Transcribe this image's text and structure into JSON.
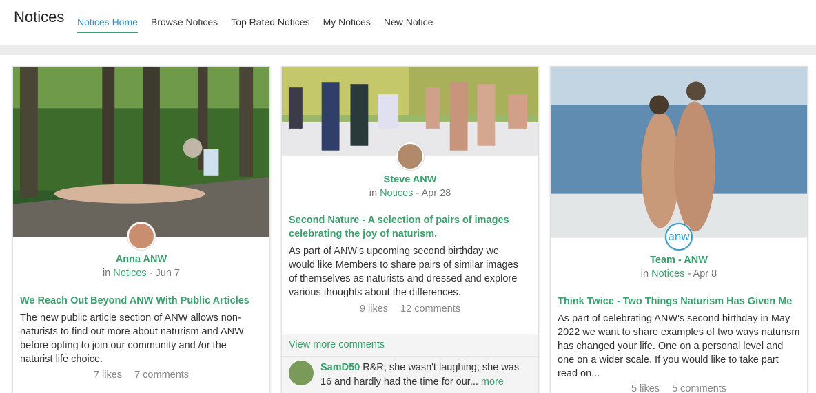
{
  "header": {
    "title": "Notices",
    "nav": [
      "Notices Home",
      "Browse Notices",
      "Top Rated Notices",
      "My Notices",
      "New Notice"
    ]
  },
  "cards": [
    {
      "author": "Anna ANW",
      "meta_prefix": "in",
      "category": "Notices",
      "date": "- Jun 7",
      "title": "We Reach Out Beyond ANW With Public Articles",
      "text": "The new public article section of ANW allows non-naturists to find out more about naturism and ANW before opting to join our community and /or the naturist life choice.",
      "likes": "7 likes",
      "comments": "7 comments",
      "image": "forest-photo-icon",
      "avatar": "user-avatar-icon"
    },
    {
      "author": "Steve ANW",
      "meta_prefix": "in",
      "category": "Notices",
      "date": "- Apr 28",
      "title": "Second Nature - A selection of pairs of images celebrating the joy of naturism.",
      "text": "As part of ANW's upcoming second birthday we would like Members to share pairs of similar images of themselves as naturists and dressed and explore various thoughts about the differences.",
      "likes": "9 likes",
      "comments": "12 comments",
      "view_more": "View more comments",
      "comment": {
        "user": "SamD50",
        "text": "R&R, she wasn't laughing; she was 16 and hardly had the time for our...",
        "more": "more"
      },
      "image": "group-photo-icon",
      "avatar": "user-avatar-icon"
    },
    {
      "author": "Team - ANW",
      "meta_prefix": "in",
      "category": "Notices",
      "date": "- Apr 8",
      "title": "Think Twice - Two Things Naturism Has Given Me",
      "text": "As part of celebrating ANW's second birthday in May 2022 we want to share examples of two ways naturism has changed your life. One on a personal level and one on a wider scale. If you would like to take part read on...",
      "likes": "5 likes",
      "comments": "5 comments",
      "image": "beach-photo-icon",
      "avatar_label": "anw"
    }
  ],
  "colors": {
    "accent": "#3aa06e",
    "active_nav": "#3a8fc7"
  }
}
